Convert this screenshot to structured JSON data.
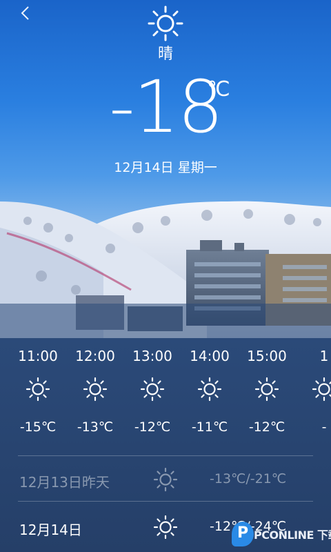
{
  "header": {
    "back_icon": "chevron-left-icon",
    "weather_icon": "sun-icon",
    "condition": "晴",
    "temperature": "-18",
    "unit": "℃",
    "date": "12月14日 星期一"
  },
  "hourly": [
    {
      "time": "11:00",
      "icon": "sun-icon",
      "temp": "-15℃"
    },
    {
      "time": "12:00",
      "icon": "sun-icon",
      "temp": "-13℃"
    },
    {
      "time": "13:00",
      "icon": "sun-icon",
      "temp": "-12℃"
    },
    {
      "time": "14:00",
      "icon": "sun-icon",
      "temp": "-11℃"
    },
    {
      "time": "15:00",
      "icon": "sun-icon",
      "temp": "-12℃"
    },
    {
      "time": "1",
      "icon": "sun-icon",
      "temp": "-"
    }
  ],
  "daily": [
    {
      "date": "12月13日昨天",
      "icon": "sun-icon",
      "range": "-13℃/-21℃",
      "faded": true
    },
    {
      "date": "12月14日",
      "icon": "sun-icon",
      "range": "-12℃/-24℃",
      "faded": false
    }
  ],
  "watermark": {
    "badge": "P",
    "text": "PCONLINE 下载"
  }
}
